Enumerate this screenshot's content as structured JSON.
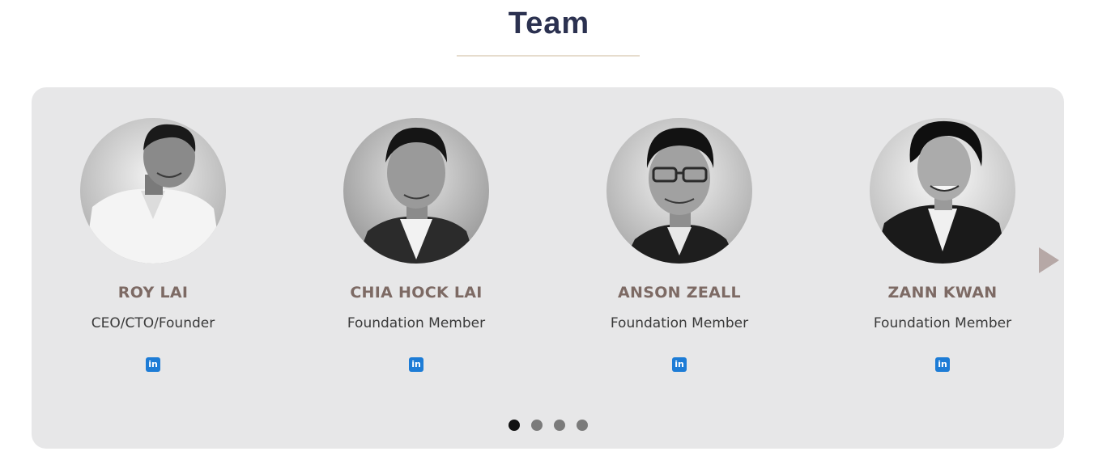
{
  "section": {
    "title": "Team"
  },
  "members": [
    {
      "name": "ROY LAI",
      "role": "CEO/CTO/Founder",
      "social_icon": "linkedin-icon",
      "social_label": "in"
    },
    {
      "name": "CHIA HOCK LAI",
      "role": "Foundation Member",
      "social_icon": "linkedin-icon",
      "social_label": "in"
    },
    {
      "name": "ANSON ZEALL",
      "role": "Foundation Member",
      "social_icon": "linkedin-icon",
      "social_label": "in"
    },
    {
      "name": "ZANN KWAN",
      "role": "Foundation Member",
      "social_icon": "linkedin-icon",
      "social_label": "in"
    }
  ],
  "carousel": {
    "next_icon": "chevron-right-icon",
    "pages": 4,
    "active_page": 1
  },
  "colors": {
    "title": "#2b3150",
    "name": "#7d6a64",
    "carousel_bg": "#e7e7e8",
    "linkedin": "#1d7cd6",
    "arrow": "#b6a8a6"
  }
}
